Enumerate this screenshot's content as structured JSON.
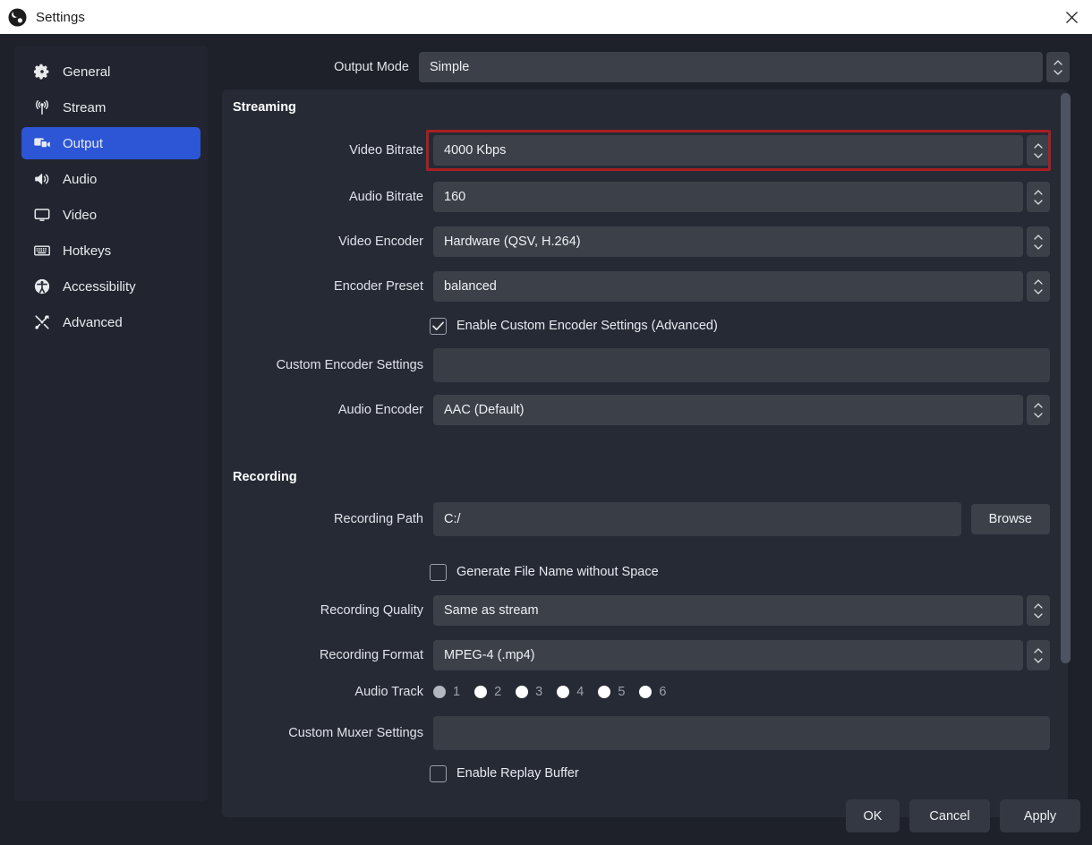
{
  "window": {
    "title": "Settings",
    "logo_icon": "obs-logo-icon",
    "close_icon": "close-icon"
  },
  "colors": {
    "accent": "#2c56d6",
    "highlight": "#a81f22",
    "panel": "#262a35",
    "field": "#3c4049",
    "background": "#1e212a",
    "titlebar": "#ffffff"
  },
  "sidebar": {
    "items": [
      {
        "label": "General",
        "icon": "gear-icon",
        "selected": false
      },
      {
        "label": "Stream",
        "icon": "broadcast-icon",
        "selected": false
      },
      {
        "label": "Output",
        "icon": "video-output-icon",
        "selected": true
      },
      {
        "label": "Audio",
        "icon": "speaker-icon",
        "selected": false
      },
      {
        "label": "Video",
        "icon": "monitor-icon",
        "selected": false
      },
      {
        "label": "Hotkeys",
        "icon": "keyboard-icon",
        "selected": false
      },
      {
        "label": "Accessibility",
        "icon": "accessibility-icon",
        "selected": false
      },
      {
        "label": "Advanced",
        "icon": "tools-icon",
        "selected": false
      }
    ]
  },
  "output_mode": {
    "label": "Output Mode",
    "value": "Simple",
    "spinner_icon": "spinner-updown-icon"
  },
  "streaming": {
    "title": "Streaming",
    "video_bitrate": {
      "label": "Video Bitrate",
      "value": "4000 Kbps",
      "highlighted": true
    },
    "audio_bitrate": {
      "label": "Audio Bitrate",
      "value": "160"
    },
    "video_encoder": {
      "label": "Video Encoder",
      "value": "Hardware (QSV, H.264)"
    },
    "encoder_preset": {
      "label": "Encoder Preset",
      "value": "balanced"
    },
    "enable_custom_encoder": {
      "label": "Enable Custom Encoder Settings (Advanced)",
      "checked": true
    },
    "custom_encoder_settings": {
      "label": "Custom Encoder Settings",
      "value": "",
      "placeholder": ""
    },
    "audio_encoder": {
      "label": "Audio Encoder",
      "value": "AAC (Default)"
    }
  },
  "recording": {
    "title": "Recording",
    "recording_path": {
      "label": "Recording Path",
      "value": "C:/",
      "placeholder": ""
    },
    "browse_button": {
      "label": "Browse"
    },
    "generate_no_space": {
      "label": "Generate File Name without Space",
      "checked": false
    },
    "recording_quality": {
      "label": "Recording Quality",
      "value": "Same as stream"
    },
    "recording_format": {
      "label": "Recording Format",
      "value": "MPEG-4 (.mp4)"
    },
    "audio_track": {
      "label": "Audio Track",
      "tracks": [
        {
          "number": "1",
          "selected": true
        },
        {
          "number": "2",
          "selected": false
        },
        {
          "number": "3",
          "selected": false
        },
        {
          "number": "4",
          "selected": false
        },
        {
          "number": "5",
          "selected": false
        },
        {
          "number": "6",
          "selected": false
        }
      ]
    },
    "custom_muxer_settings": {
      "label": "Custom Muxer Settings",
      "value": "",
      "placeholder": ""
    },
    "enable_replay_buffer": {
      "label": "Enable Replay Buffer",
      "checked": false
    }
  },
  "footer": {
    "ok": "OK",
    "cancel": "Cancel",
    "apply": "Apply"
  }
}
